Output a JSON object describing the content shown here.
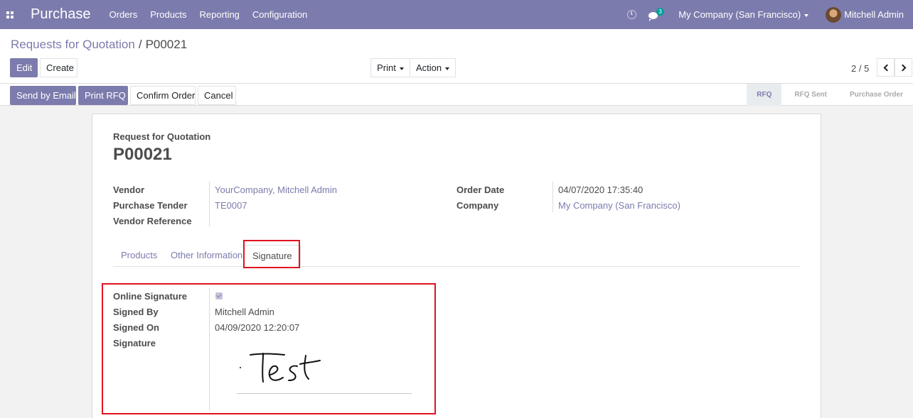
{
  "navbar": {
    "app_title": "Purchase",
    "menu": [
      "Orders",
      "Products",
      "Reporting",
      "Configuration"
    ],
    "chat_badge": "3",
    "company": "My Company (San Francisco)",
    "user": "Mitchell Admin"
  },
  "breadcrumb": {
    "parent": "Requests for Quotation",
    "separator": "/",
    "current": "P00021"
  },
  "actions": {
    "edit": "Edit",
    "create": "Create",
    "print": "Print",
    "action": "Action"
  },
  "pager": {
    "value": "2 / 5"
  },
  "header_buttons": {
    "send_by_email": "Send by Email",
    "print_rfq": "Print RFQ",
    "confirm_order": "Confirm Order",
    "cancel": "Cancel"
  },
  "statusbar": {
    "steps": [
      "RFQ",
      "RFQ Sent",
      "Purchase Order"
    ],
    "active": "RFQ"
  },
  "form": {
    "kicker": "Request for Quotation",
    "title": "P00021",
    "fields": {
      "vendor_label": "Vendor",
      "vendor_value": "YourCompany, Mitchell Admin",
      "tender_label": "Purchase Tender",
      "tender_value": "TE0007",
      "vendor_ref_label": "Vendor Reference",
      "vendor_ref_value": "",
      "order_date_label": "Order Date",
      "order_date_value": "04/07/2020 17:35:40",
      "company_label": "Company",
      "company_value": "My Company (San Francisco)"
    },
    "tabs": [
      "Products",
      "Other Information",
      "Signature"
    ],
    "active_tab": "Signature",
    "signature": {
      "online_signature_label": "Online Signature",
      "online_signature_checked": true,
      "signed_by_label": "Signed By",
      "signed_by_value": "Mitchell Admin",
      "signed_on_label": "Signed On",
      "signed_on_value": "04/09/2020 12:20:07",
      "signature_label": "Signature",
      "signature_text": "Test"
    }
  },
  "colors": {
    "brand": "#7c7bad",
    "highlight": "#e0131f",
    "badge": "#00a09d"
  }
}
